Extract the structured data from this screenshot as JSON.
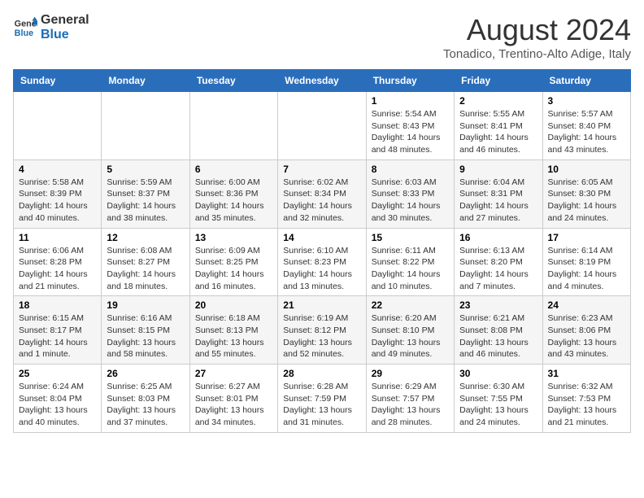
{
  "header": {
    "logo_line1": "General",
    "logo_line2": "Blue",
    "title": "August 2024",
    "subtitle": "Tonadico, Trentino-Alto Adige, Italy"
  },
  "weekdays": [
    "Sunday",
    "Monday",
    "Tuesday",
    "Wednesday",
    "Thursday",
    "Friday",
    "Saturday"
  ],
  "weeks": [
    [
      {
        "day": "",
        "info": ""
      },
      {
        "day": "",
        "info": ""
      },
      {
        "day": "",
        "info": ""
      },
      {
        "day": "",
        "info": ""
      },
      {
        "day": "1",
        "info": "Sunrise: 5:54 AM\nSunset: 8:43 PM\nDaylight: 14 hours\nand 48 minutes."
      },
      {
        "day": "2",
        "info": "Sunrise: 5:55 AM\nSunset: 8:41 PM\nDaylight: 14 hours\nand 46 minutes."
      },
      {
        "day": "3",
        "info": "Sunrise: 5:57 AM\nSunset: 8:40 PM\nDaylight: 14 hours\nand 43 minutes."
      }
    ],
    [
      {
        "day": "4",
        "info": "Sunrise: 5:58 AM\nSunset: 8:39 PM\nDaylight: 14 hours\nand 40 minutes."
      },
      {
        "day": "5",
        "info": "Sunrise: 5:59 AM\nSunset: 8:37 PM\nDaylight: 14 hours\nand 38 minutes."
      },
      {
        "day": "6",
        "info": "Sunrise: 6:00 AM\nSunset: 8:36 PM\nDaylight: 14 hours\nand 35 minutes."
      },
      {
        "day": "7",
        "info": "Sunrise: 6:02 AM\nSunset: 8:34 PM\nDaylight: 14 hours\nand 32 minutes."
      },
      {
        "day": "8",
        "info": "Sunrise: 6:03 AM\nSunset: 8:33 PM\nDaylight: 14 hours\nand 30 minutes."
      },
      {
        "day": "9",
        "info": "Sunrise: 6:04 AM\nSunset: 8:31 PM\nDaylight: 14 hours\nand 27 minutes."
      },
      {
        "day": "10",
        "info": "Sunrise: 6:05 AM\nSunset: 8:30 PM\nDaylight: 14 hours\nand 24 minutes."
      }
    ],
    [
      {
        "day": "11",
        "info": "Sunrise: 6:06 AM\nSunset: 8:28 PM\nDaylight: 14 hours\nand 21 minutes."
      },
      {
        "day": "12",
        "info": "Sunrise: 6:08 AM\nSunset: 8:27 PM\nDaylight: 14 hours\nand 18 minutes."
      },
      {
        "day": "13",
        "info": "Sunrise: 6:09 AM\nSunset: 8:25 PM\nDaylight: 14 hours\nand 16 minutes."
      },
      {
        "day": "14",
        "info": "Sunrise: 6:10 AM\nSunset: 8:23 PM\nDaylight: 14 hours\nand 13 minutes."
      },
      {
        "day": "15",
        "info": "Sunrise: 6:11 AM\nSunset: 8:22 PM\nDaylight: 14 hours\nand 10 minutes."
      },
      {
        "day": "16",
        "info": "Sunrise: 6:13 AM\nSunset: 8:20 PM\nDaylight: 14 hours\nand 7 minutes."
      },
      {
        "day": "17",
        "info": "Sunrise: 6:14 AM\nSunset: 8:19 PM\nDaylight: 14 hours\nand 4 minutes."
      }
    ],
    [
      {
        "day": "18",
        "info": "Sunrise: 6:15 AM\nSunset: 8:17 PM\nDaylight: 14 hours\nand 1 minute."
      },
      {
        "day": "19",
        "info": "Sunrise: 6:16 AM\nSunset: 8:15 PM\nDaylight: 13 hours\nand 58 minutes."
      },
      {
        "day": "20",
        "info": "Sunrise: 6:18 AM\nSunset: 8:13 PM\nDaylight: 13 hours\nand 55 minutes."
      },
      {
        "day": "21",
        "info": "Sunrise: 6:19 AM\nSunset: 8:12 PM\nDaylight: 13 hours\nand 52 minutes."
      },
      {
        "day": "22",
        "info": "Sunrise: 6:20 AM\nSunset: 8:10 PM\nDaylight: 13 hours\nand 49 minutes."
      },
      {
        "day": "23",
        "info": "Sunrise: 6:21 AM\nSunset: 8:08 PM\nDaylight: 13 hours\nand 46 minutes."
      },
      {
        "day": "24",
        "info": "Sunrise: 6:23 AM\nSunset: 8:06 PM\nDaylight: 13 hours\nand 43 minutes."
      }
    ],
    [
      {
        "day": "25",
        "info": "Sunrise: 6:24 AM\nSunset: 8:04 PM\nDaylight: 13 hours\nand 40 minutes."
      },
      {
        "day": "26",
        "info": "Sunrise: 6:25 AM\nSunset: 8:03 PM\nDaylight: 13 hours\nand 37 minutes."
      },
      {
        "day": "27",
        "info": "Sunrise: 6:27 AM\nSunset: 8:01 PM\nDaylight: 13 hours\nand 34 minutes."
      },
      {
        "day": "28",
        "info": "Sunrise: 6:28 AM\nSunset: 7:59 PM\nDaylight: 13 hours\nand 31 minutes."
      },
      {
        "day": "29",
        "info": "Sunrise: 6:29 AM\nSunset: 7:57 PM\nDaylight: 13 hours\nand 28 minutes."
      },
      {
        "day": "30",
        "info": "Sunrise: 6:30 AM\nSunset: 7:55 PM\nDaylight: 13 hours\nand 24 minutes."
      },
      {
        "day": "31",
        "info": "Sunrise: 6:32 AM\nSunset: 7:53 PM\nDaylight: 13 hours\nand 21 minutes."
      }
    ]
  ]
}
